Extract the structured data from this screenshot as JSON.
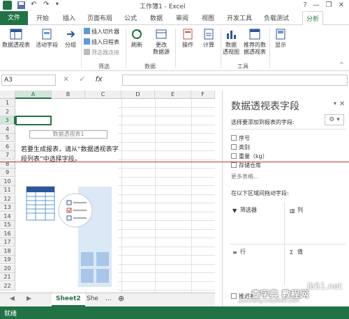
{
  "window": {
    "title": "工作簿1 - Excel",
    "question_mark": "?",
    "minimize": "—",
    "restore": "❐",
    "close": "✕"
  },
  "ribbon_tabs": [
    "文件",
    "开始",
    "插入",
    "页面布局",
    "公式",
    "数据",
    "审阅",
    "视图",
    "开发工具",
    "负载测试",
    "分析"
  ],
  "ribbon": {
    "pivot_table": "数据透视表",
    "active_field": "活动字段",
    "group": "分组",
    "insert_slicer": "插入切片器",
    "insert_timeline": "插入日程表",
    "filter_connections": "筛选器连接",
    "refresh": "刷新",
    "change_source_line1": "更改",
    "change_source_line2": "数据源",
    "actions": "操作",
    "calculations": "计算",
    "pivot_chart_line1": "数据",
    "pivot_chart_line2": "透视图",
    "recommended_line1": "推荐的数",
    "recommended_line2": "据透视表",
    "show": "显示",
    "group_filter": "筛选",
    "group_data": "数据",
    "group_tools": "工具"
  },
  "formula_bar": {
    "cell_ref": "A3",
    "cancel": "✕",
    "enter": "✓",
    "fx": "fx",
    "content": ""
  },
  "grid": {
    "columns": [
      "A",
      "B",
      "C",
      "D",
      "E",
      "F"
    ],
    "rows": [
      "1",
      "2",
      "3",
      "4",
      "5",
      "6",
      "7",
      "8",
      "9",
      "10",
      "11",
      "12",
      "13",
      "14",
      "15",
      "16",
      "17",
      "18",
      "19",
      "20",
      "21",
      "22"
    ],
    "pivot_title": "数据透视表1",
    "pivot_message": "若要生成报表，请从“数据透视表字段列表”中选择字段。"
  },
  "sheet_tabs": {
    "tabs": [
      "Sheet2",
      "She"
    ],
    "add": "⊕",
    "more": "…"
  },
  "status": {
    "text": "就绪"
  },
  "pane": {
    "title": "数据透视表字段",
    "prompt": "选择要添加到报表的字段:",
    "gear": "⚙ ▾",
    "fields": [
      "序号",
      "类别",
      "重量（kg）",
      "存储仓库",
      "更多表格..."
    ],
    "drag_prompt": "在以下区域间拖动字段:",
    "zones": {
      "filters": "筛选器",
      "columns": "列",
      "rows": "行",
      "values": "值"
    },
    "defer": "推迟布"
  },
  "watermark": {
    "brand": "查字典 教程网",
    "url": "jiaocheng.chazidian.com",
    "site": "jb51.net"
  },
  "colors": {
    "excel_green": "#217346",
    "annotation_red": "#c0392b"
  }
}
